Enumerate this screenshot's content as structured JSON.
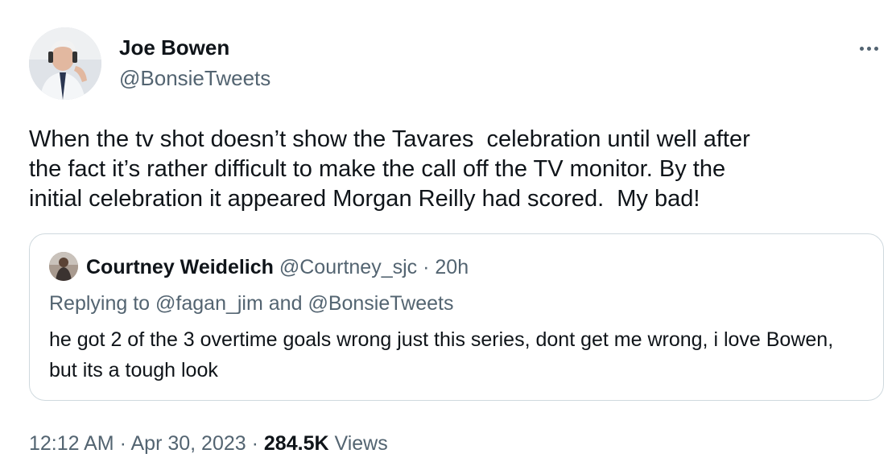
{
  "author": {
    "name": "Joe Bowen",
    "handle": "@BonsieTweets"
  },
  "tweet": {
    "text": "When the tv shot doesn’t show the Tavares  celebration until well after\nthe fact it’s rather difficult to make the call off the TV monitor. By the\ninitial celebration it appeared Morgan Reilly had scored.  My bad!"
  },
  "quoted": {
    "name": "Courtney Weidelich",
    "handle": "@Courtney_sjc",
    "separator": "·",
    "time": "20h",
    "replying_prefix": "Replying to",
    "replying_user_1": "@fagan_jim",
    "replying_and": "and",
    "replying_user_2": "@BonsieTweets",
    "text": "he got 2 of the 3 overtime goals wrong just this series, dont get me wrong, i love Bowen, but its a tough look"
  },
  "meta": {
    "time": "12:12 AM",
    "separator": "·",
    "date": "Apr 30, 2023",
    "views_count": "284.5K",
    "views_label": "Views"
  },
  "icons": {
    "more": "more-horizontal-icon"
  },
  "colors": {
    "text_primary": "#0f1419",
    "text_secondary": "#536471",
    "border": "#cfd9de",
    "background": "#ffffff"
  }
}
